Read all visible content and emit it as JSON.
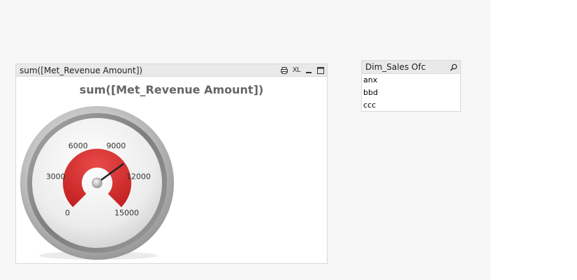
{
  "gauge_box": {
    "caption": "sum([Met_Revenue Amount])",
    "xl_label": "XL",
    "icons": [
      "print-icon",
      "export-xl-icon",
      "minimize-icon",
      "maximize-icon"
    ]
  },
  "chart_data": {
    "type": "gauge",
    "title": "sum([Met_Revenue Amount])",
    "min": 0,
    "max": 15000,
    "tick_labels": [
      "0",
      "3000",
      "6000",
      "9000",
      "12000",
      "15000"
    ],
    "value": 10500,
    "band_color": "#d42a2a",
    "needle_color": "#222222"
  },
  "listbox": {
    "caption": "Dim_Sales Ofc",
    "items": [
      "anx",
      "bbd",
      "ccc"
    ]
  }
}
